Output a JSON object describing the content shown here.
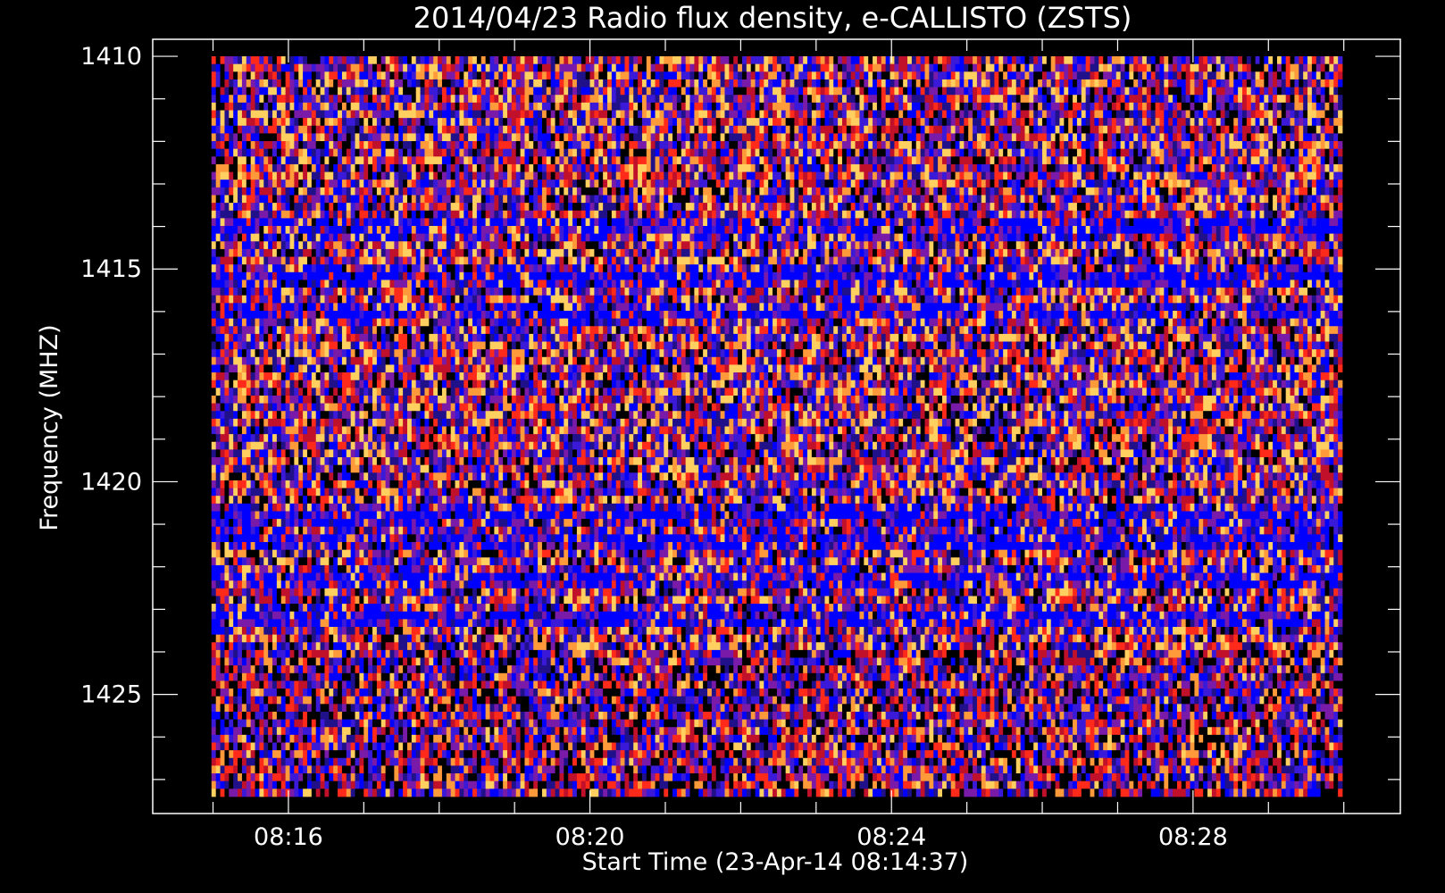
{
  "chart_data": {
    "type": "heatmap",
    "title": "2014/04/23  Radio flux density, e-CALLISTO (ZSTS)",
    "xlabel": "Start Time (23-Apr-14 08:14:37)",
    "ylabel": "Frequency (MHZ)",
    "x_ticks": [
      {
        "label": "08:16",
        "minutes": 16
      },
      {
        "label": "08:20",
        "minutes": 20
      },
      {
        "label": "08:24",
        "minutes": 24
      },
      {
        "label": "08:28",
        "minutes": 28
      }
    ],
    "y_ticks": [
      {
        "label": "1410",
        "value": 1410
      },
      {
        "label": "1415",
        "value": 1415
      },
      {
        "label": "1420",
        "value": 1420
      },
      {
        "label": "1425",
        "value": 1425
      }
    ],
    "xlim_minutes": [
      14.2,
      30.75
    ],
    "data_xlim_minutes": [
      14.98,
      29.98
    ],
    "ylim_mhz": [
      1409.6,
      1427.8
    ],
    "data_ylim_mhz": [
      1410.0,
      1427.4
    ],
    "x_minor_step_minutes": 1,
    "y_minor_step_mhz": 1,
    "colormap": [
      "#000000",
      "#20108a",
      "#3a1ad8",
      "#0000ff",
      "#7a1aa8",
      "#c0102a",
      "#ff2a1a",
      "#ff9a3a",
      "#ffd060"
    ],
    "strong_bands_mhz": [
      1414.0,
      1415.2,
      1416.0,
      1420.8,
      1421.4,
      1422.3,
      1423.2
    ],
    "grid": false
  }
}
